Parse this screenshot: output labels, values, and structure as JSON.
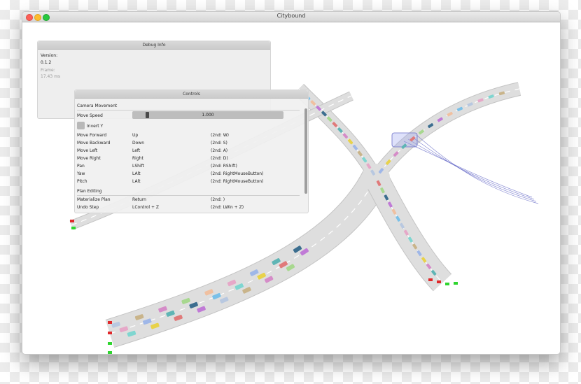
{
  "window": {
    "title": "Citybound"
  },
  "debug": {
    "title": "Debug Info",
    "version_label": "Version:",
    "version_value": "0.1.2",
    "frame_label": "Frame:",
    "frame_value": "17.43 ms"
  },
  "controls": {
    "title": "Controls",
    "camera_section": "Camera Movement",
    "move_speed_label": "Move Speed",
    "move_speed_value": "1.000",
    "invert_y_label": "Invert Y",
    "invert_y_checked": false,
    "rows": [
      {
        "action": "Move Forward",
        "key": "Up",
        "alt": "(2nd: W)"
      },
      {
        "action": "Move Backward",
        "key": "Down",
        "alt": "(2nd: S)"
      },
      {
        "action": "Move Left",
        "key": "Left",
        "alt": "(2nd: A)"
      },
      {
        "action": "Move Right",
        "key": "Right",
        "alt": "(2nd: D)"
      },
      {
        "action": "Pan",
        "key": "LShift",
        "alt": "(2nd: RShift)"
      },
      {
        "action": "Yaw",
        "key": "LAlt",
        "alt": "(2nd: RightMouseButton)"
      },
      {
        "action": "Pitch",
        "key": "LAlt",
        "alt": "(2nd: RightMouseButton)"
      }
    ],
    "plan_section": "Plan Editing",
    "plan_rows": [
      {
        "action": "Materialize Plan",
        "key": "Return",
        "alt": "(2nd: )"
      },
      {
        "action": "Undo Step",
        "key": "LControl + Z",
        "alt": "(2nd: LWin + Z)"
      }
    ]
  },
  "colors": {
    "road": "#dedede",
    "road_edge": "#c4c4c4",
    "lane_marking": "#ffffff",
    "stop_red": "#e0282a",
    "stop_green": "#2fd52f",
    "planned_outline": "#6b6fc9",
    "car_colors": [
      "#b8c8e0",
      "#e6a8c8",
      "#7fd6d0",
      "#c9b48a",
      "#9fb7e8",
      "#e8d24a",
      "#d58cc8",
      "#5fb5b5",
      "#e07a7a",
      "#a8d88f",
      "#3c6e8f",
      "#c07ad6",
      "#f0c0a0",
      "#7ac0e8"
    ]
  }
}
